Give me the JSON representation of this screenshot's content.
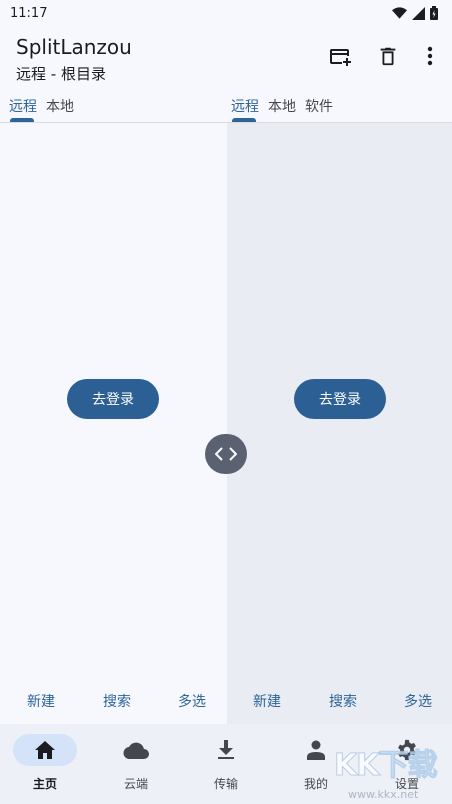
{
  "status_bar": {
    "time": "11:17"
  },
  "app_bar": {
    "title": "SplitLanzou",
    "subtitle": "远程 - 根目录",
    "actions": [
      "add-card-icon",
      "trash-icon",
      "more-vert-icon"
    ]
  },
  "left_pane": {
    "tabs": [
      {
        "label": "远程",
        "active": true
      },
      {
        "label": "本地",
        "active": false
      }
    ],
    "login_label": "去登录",
    "bottom_actions": [
      "新建",
      "搜索",
      "多选"
    ]
  },
  "right_pane": {
    "tabs": [
      {
        "label": "远程",
        "active": true
      },
      {
        "label": "本地",
        "active": false
      },
      {
        "label": "软件",
        "active": false
      }
    ],
    "login_label": "去登录",
    "bottom_actions": [
      "新建",
      "搜索",
      "多选"
    ]
  },
  "bottom_nav": [
    {
      "label": "主页",
      "icon": "home-icon",
      "active": true
    },
    {
      "label": "云端",
      "icon": "cloud-icon",
      "active": false
    },
    {
      "label": "传输",
      "icon": "download-icon",
      "active": false
    },
    {
      "label": "我的",
      "icon": "person-icon",
      "active": false
    },
    {
      "label": "设置",
      "icon": "gear-icon",
      "active": false
    }
  ],
  "watermark": {
    "text": "KK下载",
    "url": "www.kkx.net"
  },
  "colors": {
    "accent": "#2d6499",
    "button": "#2c5f94",
    "right_pane_bg": "#e9ecf3"
  }
}
